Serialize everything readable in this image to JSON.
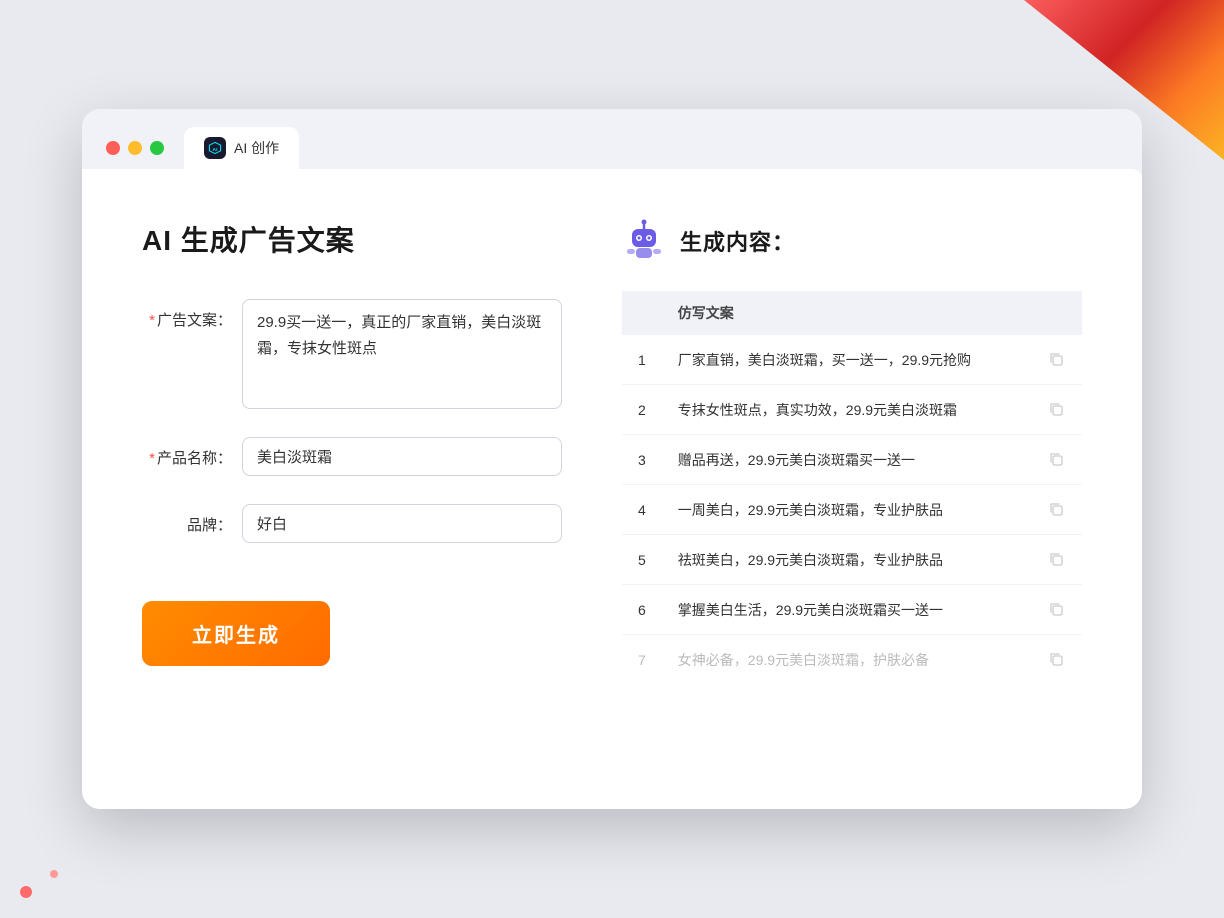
{
  "window": {
    "tab_label": "AI 创作",
    "controls": {
      "close": "close",
      "minimize": "minimize",
      "maximize": "maximize"
    }
  },
  "left_panel": {
    "title": "AI 生成广告文案",
    "form": {
      "ad_copy_label": "广告文案：",
      "ad_copy_required": "*",
      "ad_copy_value": "29.9买一送一，真正的厂家直销，美白淡斑霜，专抹女性斑点",
      "product_name_label": "产品名称：",
      "product_name_required": "*",
      "product_name_value": "美白淡斑霜",
      "brand_label": "品牌：",
      "brand_value": "好白",
      "generate_btn": "立即生成"
    }
  },
  "right_panel": {
    "header_title": "生成内容：",
    "table": {
      "column_header": "仿写文案",
      "rows": [
        {
          "num": "1",
          "text": "厂家直销，美白淡斑霜，买一送一，29.9元抢购",
          "faded": false
        },
        {
          "num": "2",
          "text": "专抹女性斑点，真实功效，29.9元美白淡斑霜",
          "faded": false
        },
        {
          "num": "3",
          "text": "赠品再送，29.9元美白淡斑霜买一送一",
          "faded": false
        },
        {
          "num": "4",
          "text": "一周美白，29.9元美白淡斑霜，专业护肤品",
          "faded": false
        },
        {
          "num": "5",
          "text": "祛斑美白，29.9元美白淡斑霜，专业护肤品",
          "faded": false
        },
        {
          "num": "6",
          "text": "掌握美白生活，29.9元美白淡斑霜买一送一",
          "faded": false
        },
        {
          "num": "7",
          "text": "女神必备，29.9元美白淡斑霜，护肤必备",
          "faded": true
        }
      ]
    }
  },
  "colors": {
    "accent_orange": "#ff6b00",
    "required_red": "#ff4d4d",
    "robot_purple": "#6b5ce7",
    "tab_bg": "#ffffff"
  }
}
